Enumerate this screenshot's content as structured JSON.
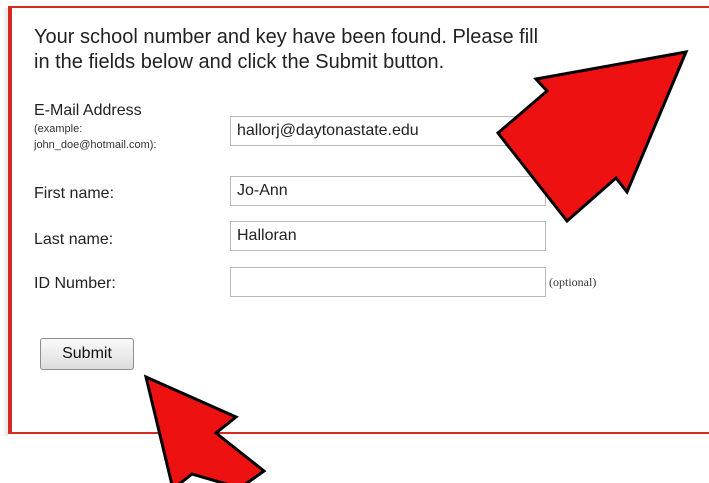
{
  "form": {
    "intro_line1": "Your school number and key have been found. Please fill",
    "intro_line2": "in the fields below and click the Submit button.",
    "email": {
      "label": "E-Mail Address",
      "hint_line1": "(example:",
      "hint_line2": "john_doe@hotmail.com):",
      "value": "hallorj@daytonastate.edu"
    },
    "first_name": {
      "label": "First name:",
      "value": "Jo-Ann"
    },
    "last_name": {
      "label": "Last name:",
      "value": "Halloran"
    },
    "id_number": {
      "label": "ID Number:",
      "value": "",
      "note": "(optional)"
    },
    "submit_label": "Submit"
  },
  "annotations": {
    "arrow_color": "#ee1111",
    "arrow_outline": "#000000"
  },
  "colors": {
    "panel_border": "#d42a22"
  }
}
